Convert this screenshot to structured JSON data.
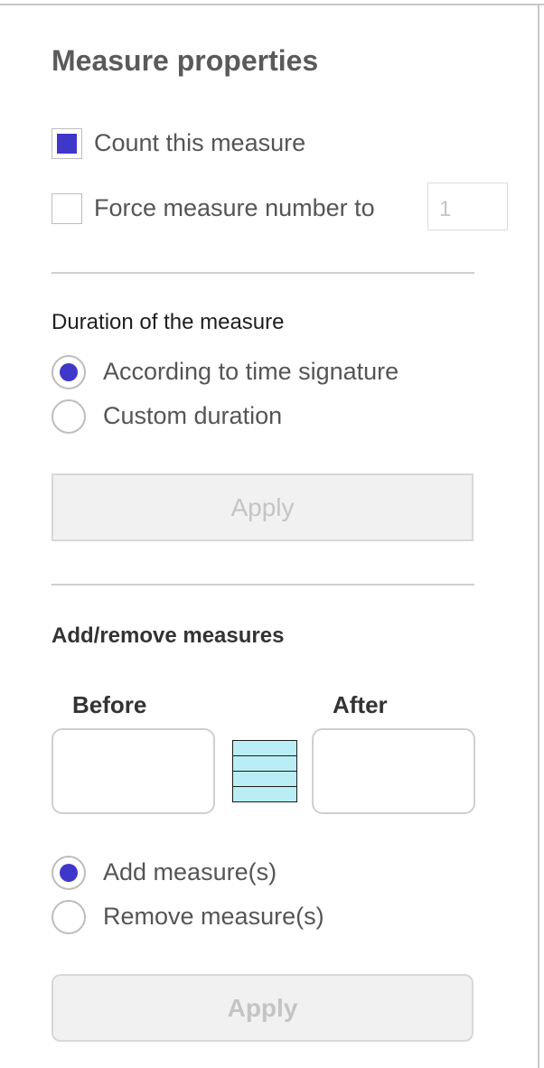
{
  "panel": {
    "title": "Measure properties",
    "count_measure": {
      "label": "Count this measure",
      "checked": true
    },
    "force_number": {
      "label": "Force measure number to",
      "checked": false,
      "placeholder": "1"
    },
    "duration": {
      "heading": "Duration of the measure",
      "options": [
        {
          "label": "According to time signature",
          "selected": true
        },
        {
          "label": "Custom duration",
          "selected": false
        }
      ],
      "apply_label": "Apply"
    },
    "add_remove": {
      "heading": "Add/remove measures",
      "before_label": "Before",
      "after_label": "After",
      "options": [
        {
          "label": "Add measure(s)",
          "selected": true
        },
        {
          "label": "Remove measure(s)",
          "selected": false
        }
      ],
      "apply_label": "Apply"
    }
  },
  "colors": {
    "accent": "#3f37c9",
    "measure_icon_fill": "#b9eef4",
    "disabled_text": "#c4c4c4"
  },
  "icons": {
    "measure_icon": "measure-staff-icon"
  }
}
